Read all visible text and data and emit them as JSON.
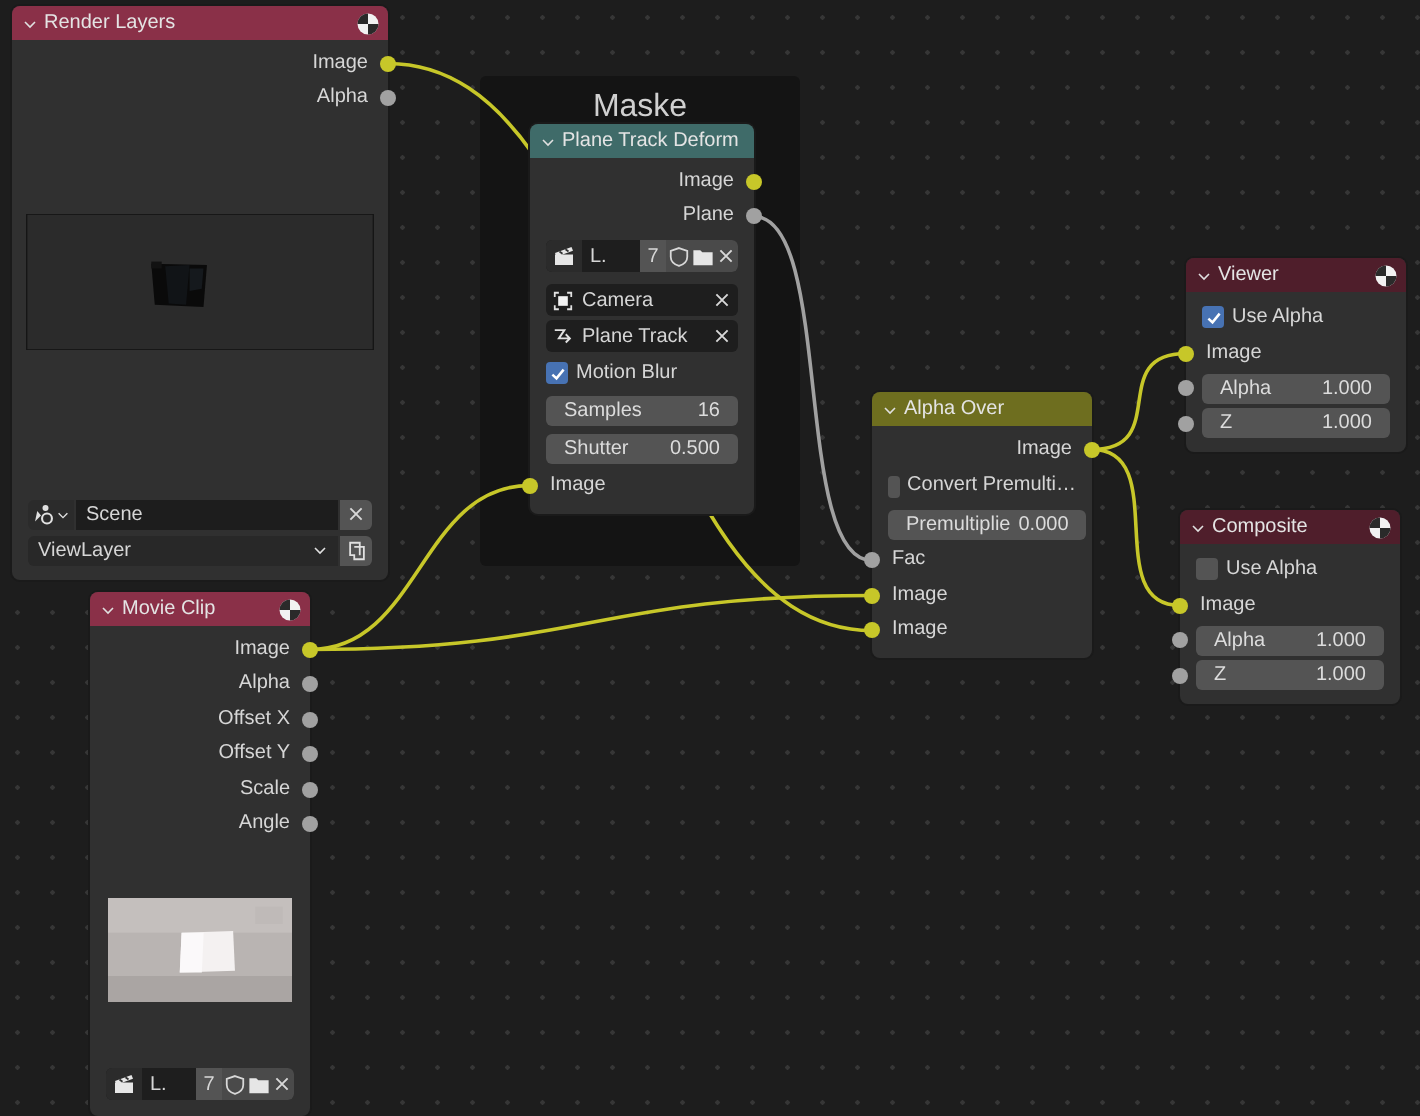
{
  "frame": {
    "label": "Maske"
  },
  "nodes": [
    {
      "title": "Render Layers",
      "color": "#8a3048",
      "sphere_icon": true,
      "rows": [
        {
          "kind": "output",
          "label": "Image",
          "color": "#c7c729"
        },
        {
          "kind": "output",
          "label": "Alpha",
          "color": "#a1a1a1"
        },
        {
          "kind": "picture"
        },
        {
          "kind": "scene_field",
          "value": "Scene"
        },
        {
          "kind": "dropdown",
          "value": "ViewLayer"
        }
      ]
    },
    {
      "title": "Plane Track Deform",
      "color": "#3f6b69",
      "sphere_icon": false,
      "rows": [
        {
          "kind": "output",
          "label": "Image",
          "color": "#c7c729"
        },
        {
          "kind": "output",
          "label": "Plane",
          "color": "#a1a1a1"
        },
        {
          "kind": "clip_selector",
          "name": "L.",
          "users": "7"
        },
        {
          "kind": "object_field",
          "value": "Camera"
        },
        {
          "kind": "track_field",
          "value": "Plane Track"
        },
        {
          "kind": "checkbox",
          "label": "Motion Blur",
          "checked": true
        },
        {
          "kind": "value",
          "label": "Samples",
          "value": "16"
        },
        {
          "kind": "value",
          "label": "Shutter",
          "value": "0.500"
        },
        {
          "kind": "input",
          "label": "Image",
          "color": "#c7c729"
        }
      ]
    },
    {
      "title": "Movie Clip",
      "color": "#8a3048",
      "sphere_icon": true,
      "rows": [
        {
          "kind": "output",
          "label": "Image",
          "color": "#c7c729"
        },
        {
          "kind": "output",
          "label": "Alpha",
          "color": "#a1a1a1"
        },
        {
          "kind": "output",
          "label": "Offset X",
          "color": "#a1a1a1"
        },
        {
          "kind": "output",
          "label": "Offset Y",
          "color": "#a1a1a1"
        },
        {
          "kind": "output",
          "label": "Scale",
          "color": "#a1a1a1"
        },
        {
          "kind": "output",
          "label": "Angle",
          "color": "#a1a1a1"
        },
        {
          "kind": "picture"
        },
        {
          "kind": "clip_selector",
          "name": "L.",
          "users": "7"
        }
      ]
    },
    {
      "title": "Alpha Over",
      "color": "#6e6e1f",
      "sphere_icon": false,
      "rows": [
        {
          "kind": "output",
          "label": "Image",
          "color": "#c7c729"
        },
        {
          "kind": "checkbox",
          "label": "Convert Premulti…",
          "checked": false
        },
        {
          "kind": "value",
          "label": "Premultiplie",
          "value": "0.000"
        },
        {
          "kind": "input",
          "label": "Fac",
          "color": "#a1a1a1"
        },
        {
          "kind": "input",
          "label": "Image",
          "color": "#c7c729"
        },
        {
          "kind": "input",
          "label": "Image",
          "color": "#c7c729"
        }
      ]
    },
    {
      "title": "Viewer",
      "color": "#4f1e2b",
      "sphere_icon": true,
      "rows": [
        {
          "kind": "checkbox",
          "label": "Use Alpha",
          "checked": true
        },
        {
          "kind": "input",
          "label": "Image",
          "color": "#c7c729"
        },
        {
          "kind": "input_value",
          "label": "Alpha",
          "value": "1.000",
          "color": "#a1a1a1"
        },
        {
          "kind": "input_value",
          "label": "Z",
          "value": "1.000",
          "color": "#a1a1a1"
        }
      ]
    },
    {
      "title": "Composite",
      "color": "#4f1e2b",
      "sphere_icon": true,
      "rows": [
        {
          "kind": "checkbox",
          "label": "Use Alpha",
          "checked": false
        },
        {
          "kind": "input",
          "label": "Image",
          "color": "#c7c729"
        },
        {
          "kind": "input_value",
          "label": "Alpha",
          "value": "1.000",
          "color": "#a1a1a1"
        },
        {
          "kind": "input_value",
          "label": "Z",
          "value": "1.000",
          "color": "#a1a1a1"
        }
      ]
    }
  ]
}
